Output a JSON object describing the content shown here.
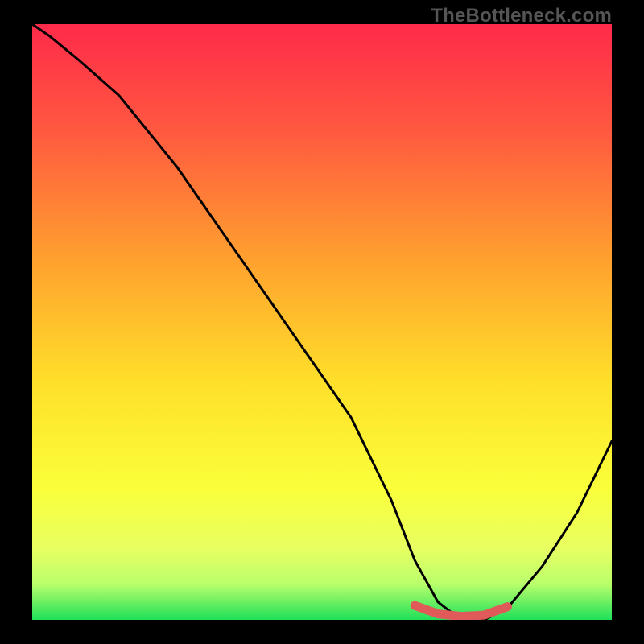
{
  "watermark": "TheBottleneck.com",
  "chart_data": {
    "type": "line",
    "title": "",
    "xlabel": "",
    "ylabel": "",
    "xlim": [
      0,
      100
    ],
    "ylim": [
      0,
      100
    ],
    "grid": false,
    "legend": false,
    "gradient_stops": [
      {
        "pct": 0,
        "color": "#ff2a4a"
      },
      {
        "pct": 18,
        "color": "#ff5940"
      },
      {
        "pct": 40,
        "color": "#ffa22e"
      },
      {
        "pct": 60,
        "color": "#ffdf2a"
      },
      {
        "pct": 78,
        "color": "#faff3a"
      },
      {
        "pct": 88,
        "color": "#e8ff62"
      },
      {
        "pct": 94,
        "color": "#b9ff6b"
      },
      {
        "pct": 100,
        "color": "#1fe05a"
      }
    ],
    "series": [
      {
        "name": "curve",
        "color": "#000000",
        "x": [
          0,
          3,
          8,
          15,
          25,
          35,
          45,
          55,
          62,
          66,
          70,
          74,
          78,
          82,
          88,
          94,
          100
        ],
        "y": [
          100,
          98,
          94,
          88,
          76,
          62,
          48,
          34,
          20,
          10,
          3,
          0,
          0,
          2,
          9,
          18,
          30
        ]
      }
    ],
    "highlight_segment": {
      "name": "bottom-band",
      "color": "#e05a5a",
      "x": [
        66,
        70,
        74,
        78,
        82
      ],
      "y": [
        2.4,
        1.0,
        0.6,
        0.8,
        2.2
      ]
    }
  }
}
